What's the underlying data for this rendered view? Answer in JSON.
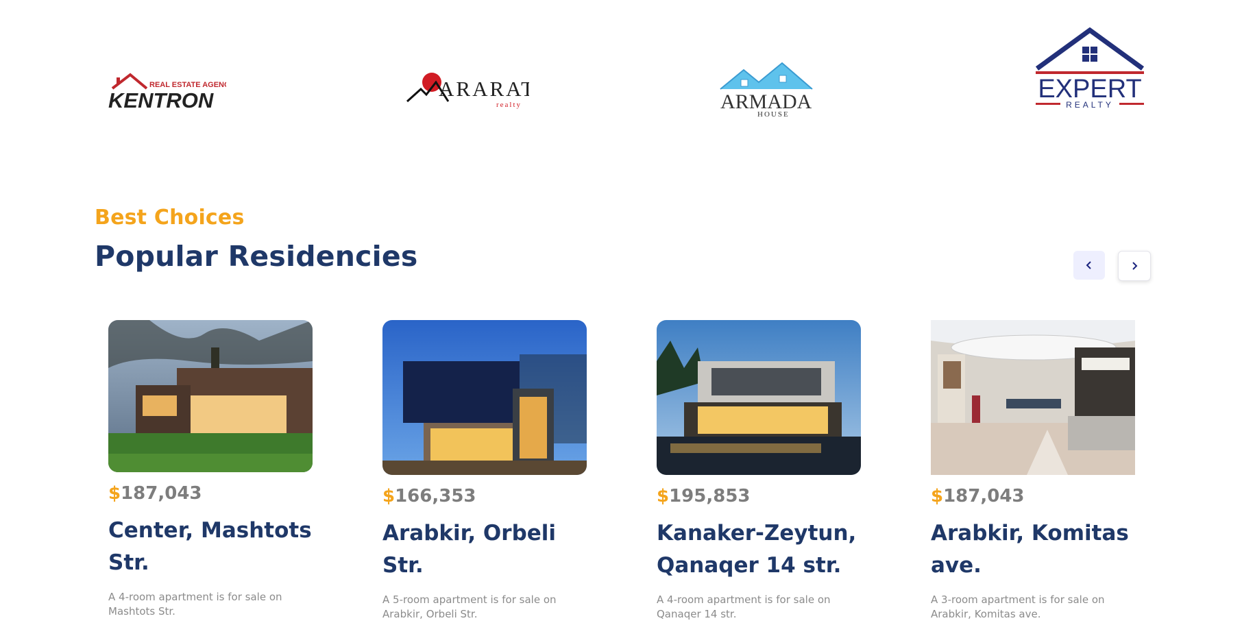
{
  "logos": [
    {
      "name": "KENTRON",
      "tagline": "REAL ESTATE AGENCY"
    },
    {
      "name": "ARARAT",
      "tagline": "realty"
    },
    {
      "name": "ARMADA",
      "tagline": "HOUSE"
    },
    {
      "name": "EXPERT",
      "tagline": "REALTY"
    }
  ],
  "section": {
    "eyebrow": "Best Choices",
    "title": "Popular Residencies"
  },
  "carousel": {
    "prev_icon": "chevron-left-icon",
    "next_icon": "chevron-right-icon"
  },
  "cards": [
    {
      "currency": "$",
      "price": "187,043",
      "title": "Center, Mashtots Str.",
      "description": "A 4-room apartment is for sale on Mashtots Str."
    },
    {
      "currency": "$",
      "price": "166,353",
      "title": "Arabkir, Orbeli Str.",
      "description": "A 5-room apartment is for sale on Arabkir, Orbeli Str."
    },
    {
      "currency": "$",
      "price": "195,853",
      "title": "Kanaker-Zeytun, Qanaqer 14 str.",
      "description": "A 4-room apartment is for sale on Qanaqer 14 str."
    },
    {
      "currency": "$",
      "price": "187,043",
      "title": "Arabkir, Komitas ave.",
      "description": "A 3-room apartment is for sale on Arabkir, Komitas ave."
    }
  ],
  "colors": {
    "accent": "#f4a41c",
    "heading": "#1f3868",
    "muted": "#8b8b8b"
  }
}
